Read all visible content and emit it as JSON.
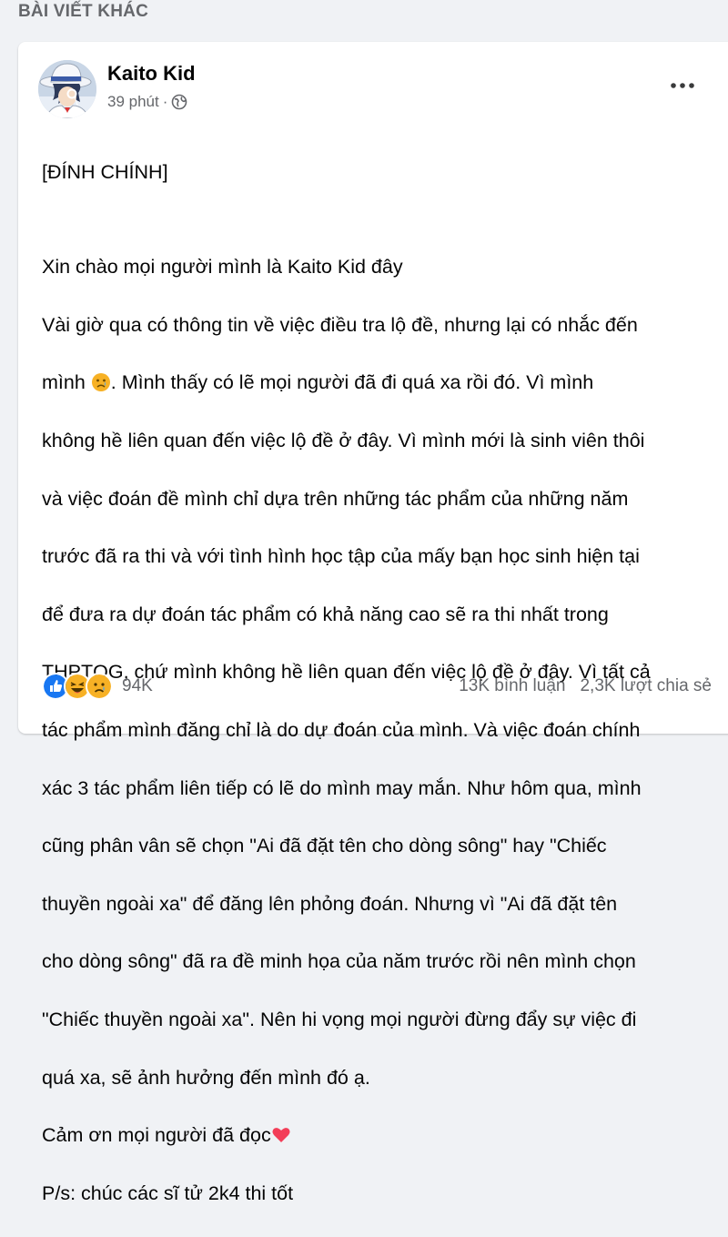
{
  "section": {
    "title": "BÀI VIẾT KHÁC"
  },
  "post": {
    "author": "Kaito Kid",
    "time": "39 phút",
    "separator": "·",
    "heading": "[ĐÍNH CHÍNH]",
    "lines": [
      "Xin chào mọi người mình là Kaito Kid đây",
      "Vài giờ qua có thông tin về việc điều tra lộ đề, nhưng lại có nhắc đến",
      "mình",
      ". Mình thấy có lẽ mọi người đã đi quá xa rồi đó. Vì mình",
      "không hề liên quan đến việc lộ đề ở đây. Vì mình mới là sinh viên thôi",
      "và việc đoán đề mình chỉ dựa trên những tác phẩm của những năm",
      "trước đã ra thi và với tình hình học tập của mấy bạn học sinh hiện tại",
      "để đưa ra dự đoán tác phẩm có khả năng cao sẽ ra thi nhất trong",
      "THPTQG, chứ mình không hề liên quan đến việc lộ đề ở đây. Vì tất cả",
      "tác phẩm mình đăng chỉ là do dự đoán của mình. Và việc đoán chính",
      "xác 3 tác phẩm liên tiếp có lẽ do mình may mắn. Như hôm qua, mình",
      "cũng phân vân sẽ chọn \"Ai đã đặt tên cho dòng sông\" hay \"Chiếc",
      "thuyền ngoài xa\" để đăng lên phỏng đoán. Nhưng vì \"Ai đã đặt tên",
      "cho dòng sông\" đã ra đề minh họa của năm trước rồi nên mình chọn",
      "\"Chiếc thuyền ngoài xa\". Nên hi vọng mọi người đừng đẩy sự việc đi",
      "quá xa, sẽ ảnh hưởng đến mình đó ạ.",
      "Cảm ơn mọi người đã đọc",
      "P/s: chúc các sĩ tử 2k4 thi tốt"
    ],
    "reaction_count": "94K",
    "comments": "13K bình luận",
    "shares": "2,3K lượt chia sẻ"
  },
  "colors": {
    "background": "#f0f2f5",
    "secondary_text": "#65676b",
    "like_blue": "#1877f2",
    "heart_red": "#f33e58",
    "emoji_yellow": "#f7b125"
  },
  "icons": [
    "globe-icon",
    "more-options-icon",
    "sad-emoji-icon",
    "heart-emoji-icon",
    "like-reaction-icon",
    "haha-reaction-icon",
    "sad-reaction-icon"
  ]
}
